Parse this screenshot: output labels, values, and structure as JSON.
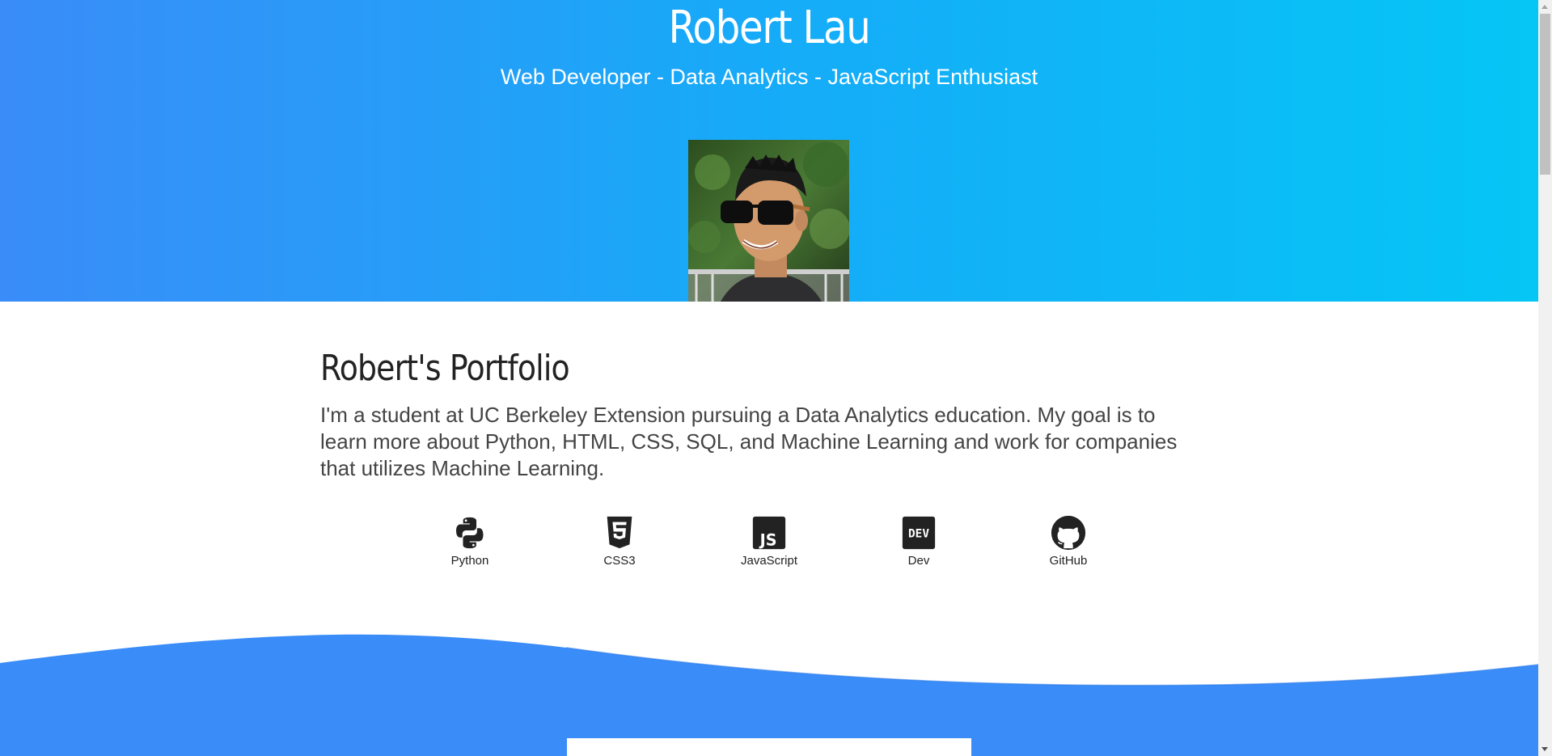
{
  "hero": {
    "name": "Robert Lau",
    "tagline": "Web Developer - Data Analytics - JavaScript Enthusiast",
    "gradient": [
      "#3a8cf8",
      "#05c6f5"
    ]
  },
  "about": {
    "heading": "Robert's Portfolio",
    "text": "I'm a student at UC Berkeley Extension pursuing a Data Analytics education. My goal is to learn more about Python, HTML, CSS, SQL, and Machine Learning and work for companies that utilizes Machine Learning."
  },
  "skills": [
    {
      "label": "Python",
      "icon": "python-icon"
    },
    {
      "label": "CSS3",
      "icon": "css3-icon"
    },
    {
      "label": "JavaScript",
      "icon": "javascript-icon"
    },
    {
      "label": "Dev",
      "icon": "dev-icon"
    },
    {
      "label": "GitHub",
      "icon": "github-icon"
    }
  ],
  "colors": {
    "wave": "#3a8cf8",
    "text": "#222222"
  }
}
